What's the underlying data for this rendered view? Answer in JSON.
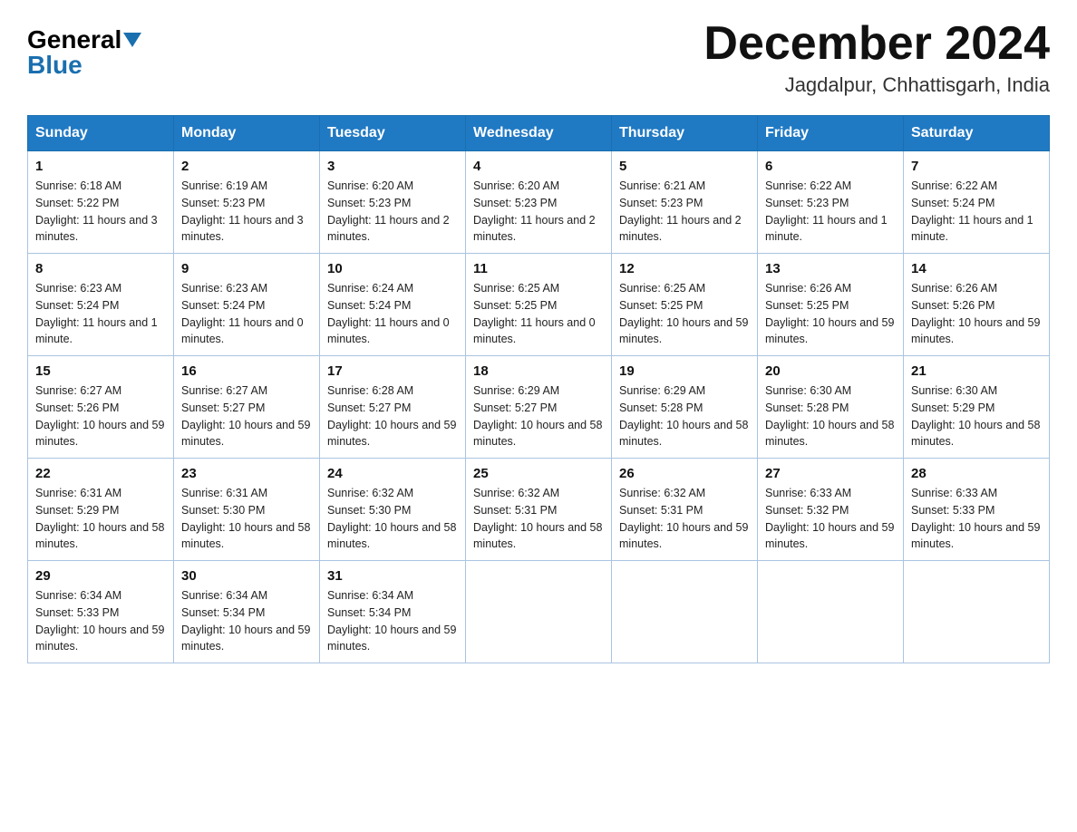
{
  "header": {
    "logo_general": "General",
    "logo_blue": "Blue",
    "month_title": "December 2024",
    "location": "Jagdalpur, Chhattisgarh, India"
  },
  "days_of_week": [
    "Sunday",
    "Monday",
    "Tuesday",
    "Wednesday",
    "Thursday",
    "Friday",
    "Saturday"
  ],
  "weeks": [
    [
      {
        "day": "1",
        "sunrise": "6:18 AM",
        "sunset": "5:22 PM",
        "daylight": "11 hours and 3 minutes."
      },
      {
        "day": "2",
        "sunrise": "6:19 AM",
        "sunset": "5:23 PM",
        "daylight": "11 hours and 3 minutes."
      },
      {
        "day": "3",
        "sunrise": "6:20 AM",
        "sunset": "5:23 PM",
        "daylight": "11 hours and 2 minutes."
      },
      {
        "day": "4",
        "sunrise": "6:20 AM",
        "sunset": "5:23 PM",
        "daylight": "11 hours and 2 minutes."
      },
      {
        "day": "5",
        "sunrise": "6:21 AM",
        "sunset": "5:23 PM",
        "daylight": "11 hours and 2 minutes."
      },
      {
        "day": "6",
        "sunrise": "6:22 AM",
        "sunset": "5:23 PM",
        "daylight": "11 hours and 1 minute."
      },
      {
        "day": "7",
        "sunrise": "6:22 AM",
        "sunset": "5:24 PM",
        "daylight": "11 hours and 1 minute."
      }
    ],
    [
      {
        "day": "8",
        "sunrise": "6:23 AM",
        "sunset": "5:24 PM",
        "daylight": "11 hours and 1 minute."
      },
      {
        "day": "9",
        "sunrise": "6:23 AM",
        "sunset": "5:24 PM",
        "daylight": "11 hours and 0 minutes."
      },
      {
        "day": "10",
        "sunrise": "6:24 AM",
        "sunset": "5:24 PM",
        "daylight": "11 hours and 0 minutes."
      },
      {
        "day": "11",
        "sunrise": "6:25 AM",
        "sunset": "5:25 PM",
        "daylight": "11 hours and 0 minutes."
      },
      {
        "day": "12",
        "sunrise": "6:25 AM",
        "sunset": "5:25 PM",
        "daylight": "10 hours and 59 minutes."
      },
      {
        "day": "13",
        "sunrise": "6:26 AM",
        "sunset": "5:25 PM",
        "daylight": "10 hours and 59 minutes."
      },
      {
        "day": "14",
        "sunrise": "6:26 AM",
        "sunset": "5:26 PM",
        "daylight": "10 hours and 59 minutes."
      }
    ],
    [
      {
        "day": "15",
        "sunrise": "6:27 AM",
        "sunset": "5:26 PM",
        "daylight": "10 hours and 59 minutes."
      },
      {
        "day": "16",
        "sunrise": "6:27 AM",
        "sunset": "5:27 PM",
        "daylight": "10 hours and 59 minutes."
      },
      {
        "day": "17",
        "sunrise": "6:28 AM",
        "sunset": "5:27 PM",
        "daylight": "10 hours and 59 minutes."
      },
      {
        "day": "18",
        "sunrise": "6:29 AM",
        "sunset": "5:27 PM",
        "daylight": "10 hours and 58 minutes."
      },
      {
        "day": "19",
        "sunrise": "6:29 AM",
        "sunset": "5:28 PM",
        "daylight": "10 hours and 58 minutes."
      },
      {
        "day": "20",
        "sunrise": "6:30 AM",
        "sunset": "5:28 PM",
        "daylight": "10 hours and 58 minutes."
      },
      {
        "day": "21",
        "sunrise": "6:30 AM",
        "sunset": "5:29 PM",
        "daylight": "10 hours and 58 minutes."
      }
    ],
    [
      {
        "day": "22",
        "sunrise": "6:31 AM",
        "sunset": "5:29 PM",
        "daylight": "10 hours and 58 minutes."
      },
      {
        "day": "23",
        "sunrise": "6:31 AM",
        "sunset": "5:30 PM",
        "daylight": "10 hours and 58 minutes."
      },
      {
        "day": "24",
        "sunrise": "6:32 AM",
        "sunset": "5:30 PM",
        "daylight": "10 hours and 58 minutes."
      },
      {
        "day": "25",
        "sunrise": "6:32 AM",
        "sunset": "5:31 PM",
        "daylight": "10 hours and 58 minutes."
      },
      {
        "day": "26",
        "sunrise": "6:32 AM",
        "sunset": "5:31 PM",
        "daylight": "10 hours and 59 minutes."
      },
      {
        "day": "27",
        "sunrise": "6:33 AM",
        "sunset": "5:32 PM",
        "daylight": "10 hours and 59 minutes."
      },
      {
        "day": "28",
        "sunrise": "6:33 AM",
        "sunset": "5:33 PM",
        "daylight": "10 hours and 59 minutes."
      }
    ],
    [
      {
        "day": "29",
        "sunrise": "6:34 AM",
        "sunset": "5:33 PM",
        "daylight": "10 hours and 59 minutes."
      },
      {
        "day": "30",
        "sunrise": "6:34 AM",
        "sunset": "5:34 PM",
        "daylight": "10 hours and 59 minutes."
      },
      {
        "day": "31",
        "sunrise": "6:34 AM",
        "sunset": "5:34 PM",
        "daylight": "10 hours and 59 minutes."
      },
      null,
      null,
      null,
      null
    ]
  ]
}
